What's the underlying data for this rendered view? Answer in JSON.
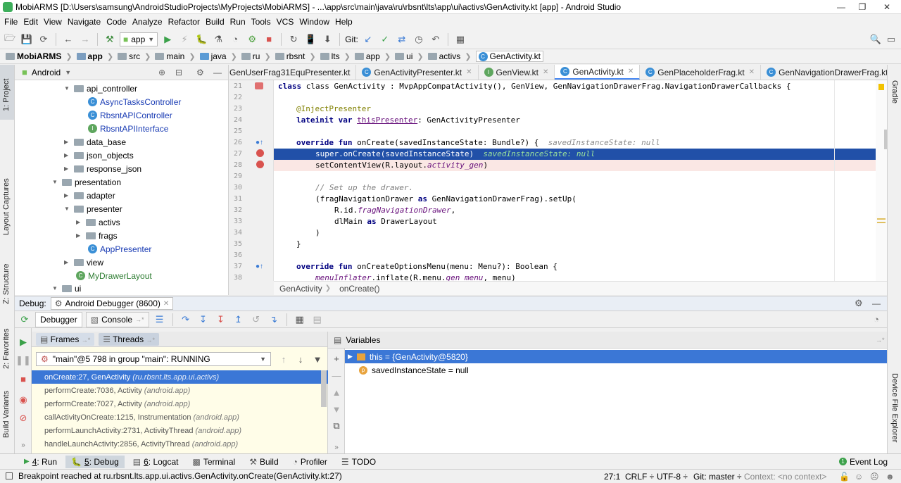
{
  "window": {
    "title": "MobiARMS [D:\\Users\\samsung\\AndroidStudioProjects\\MyProjects\\MobiARMS] - ...\\app\\src\\main\\java\\ru\\rbsnt\\lts\\app\\ui\\activs\\GenActivity.kt [app] - Android Studio"
  },
  "menu": [
    "File",
    "Edit",
    "View",
    "Navigate",
    "Code",
    "Analyze",
    "Refactor",
    "Build",
    "Run",
    "Tools",
    "VCS",
    "Window",
    "Help"
  ],
  "toolbar": {
    "run_config": "app",
    "git_label": "Git:"
  },
  "breadcrumb": [
    "MobiARMS",
    "app",
    "src",
    "main",
    "java",
    "ru",
    "rbsnt",
    "lts",
    "app",
    "ui",
    "activs",
    "GenActivity.kt"
  ],
  "left_strip": {
    "project": "1: Project",
    "captures": "Layout Captures",
    "structure": "Z: Structure",
    "favorites": "2: Favorites",
    "variants": "Build Variants"
  },
  "right_strip": {
    "gradle": "Gradle",
    "device": "Device File Explorer"
  },
  "project_panel": {
    "view_mode": "Android",
    "items": [
      {
        "label": "api_controller",
        "kind": "folder",
        "expanded": true
      },
      {
        "label": "AsyncTasksController",
        "kind": "class"
      },
      {
        "label": "RbsntAPIController",
        "kind": "class"
      },
      {
        "label": "RbsntAPIInterface",
        "kind": "interface"
      },
      {
        "label": "data_base",
        "kind": "folder",
        "expanded": false
      },
      {
        "label": "json_objects",
        "kind": "folder",
        "expanded": false
      },
      {
        "label": "response_json",
        "kind": "folder",
        "expanded": false
      },
      {
        "label": "presentation",
        "kind": "folder",
        "expanded": true
      },
      {
        "label": "adapter",
        "kind": "folder",
        "expanded": false
      },
      {
        "label": "presenter",
        "kind": "folder",
        "expanded": true
      },
      {
        "label": "activs",
        "kind": "folder",
        "expanded": false
      },
      {
        "label": "frags",
        "kind": "folder",
        "expanded": false
      },
      {
        "label": "AppPresenter",
        "kind": "class"
      },
      {
        "label": "view",
        "kind": "folder",
        "expanded": false
      },
      {
        "label": "MyDrawerLayout",
        "kind": "class-green"
      },
      {
        "label": "ui",
        "kind": "folder",
        "expanded": true
      }
    ]
  },
  "editor": {
    "tabs": [
      "GenUserFrag31EquPresenter.kt",
      "GenActivityPresenter.kt",
      "GenView.kt",
      "GenActivity.kt",
      "GenPlaceholderFrag.kt",
      "GenNavigationDrawerFrag.kt"
    ],
    "active_tab": "GenActivity.kt",
    "tab_overflow": "≪5",
    "line_numbers": [
      "21",
      "22",
      "23",
      "24",
      "25",
      "26",
      "27",
      "28",
      "29",
      "30",
      "31",
      "32",
      "33",
      "34",
      "35",
      "36",
      "37",
      "38"
    ],
    "code": {
      "l21": "class GenActivity : MvpAppCompatActivity(), GenView, GenNavigationDrawerFrag.NavigationDrawerCallbacks {",
      "l23": "@InjectPresenter",
      "l24_kw": "lateinit var ",
      "l24_name": "thisPresenter",
      "l24_rest": ": GenActivityPresenter",
      "l26_kw": "override fun ",
      "l26_rest": "onCreate(savedInstanceState: Bundle?) {",
      "l26_hint": "savedInstanceState: null",
      "l27": "super.onCreate(savedInstanceState)",
      "l27_hint": "savedInstanceState: null",
      "l28_a": "setContentView(R.layout.",
      "l28_b": "activity_gen",
      "l28_c": ")",
      "l30": "// Set up the drawer.",
      "l31_a": "(fragNavigationDrawer ",
      "l31_kw": "as",
      "l31_b": " GenNavigationDrawerFrag).setUp(",
      "l32_a": "R.id.",
      "l32_b": "fragNavigationDrawer",
      "l32_c": ",",
      "l33_a": "dlMain ",
      "l33_kw": "as",
      "l33_b": " DrawerLayout",
      "l34": ")",
      "l35": "}",
      "l37_kw": "override fun ",
      "l37_rest": "onCreateOptionsMenu(menu: Menu?): Boolean {",
      "l38_a": "menuInflater",
      "l38_b": ".inflate(R.menu.",
      "l38_c": "gen_menu",
      "l38_d": ", menu)"
    },
    "crumb": [
      "GenActivity",
      "onCreate()"
    ]
  },
  "debug": {
    "label": "Debug:",
    "session": "Android Debugger (8600)",
    "tab_debugger": "Debugger",
    "tab_console": "Console",
    "frames_label": "Frames",
    "threads_label": "Threads",
    "variables_label": "Variables",
    "thread": "\"main\"@5 798 in group \"main\": RUNNING",
    "frames": [
      {
        "name": "onCreate:27, GenActivity",
        "pkg": "(ru.rbsnt.lts.app.ui.activs)"
      },
      {
        "name": "performCreate:7036, Activity",
        "pkg": "(android.app)"
      },
      {
        "name": "performCreate:7027, Activity",
        "pkg": "(android.app)"
      },
      {
        "name": "callActivityOnCreate:1215, Instrumentation",
        "pkg": "(android.app)"
      },
      {
        "name": "performLaunchActivity:2731, ActivityThread",
        "pkg": "(android.app)"
      },
      {
        "name": "handleLaunchActivity:2856, ActivityThread",
        "pkg": "(android.app)"
      }
    ],
    "variables": [
      {
        "name": "this = {GenActivity@5820}"
      },
      {
        "name": "savedInstanceState = null"
      }
    ]
  },
  "bottom_tabs": [
    {
      "num": "4",
      "label": ": Run"
    },
    {
      "num": "5",
      "label": ": Debug"
    },
    {
      "num": "6",
      "label": ": Logcat"
    },
    {
      "num": "",
      "label": "Terminal"
    },
    {
      "num": "",
      "label": "Build"
    },
    {
      "num": "",
      "label": "Profiler"
    },
    {
      "num": "",
      "label": "TODO"
    }
  ],
  "event_log": "Event Log",
  "status": {
    "message": "Breakpoint reached at ru.rbsnt.lts.app.ui.activs.GenActivity.onCreate(GenActivity.kt:27)",
    "position": "27:1",
    "line_sep": "CRLF ÷",
    "encoding": "UTF-8 ÷",
    "git": "Git: master ÷",
    "context": "Context: <no context>"
  }
}
